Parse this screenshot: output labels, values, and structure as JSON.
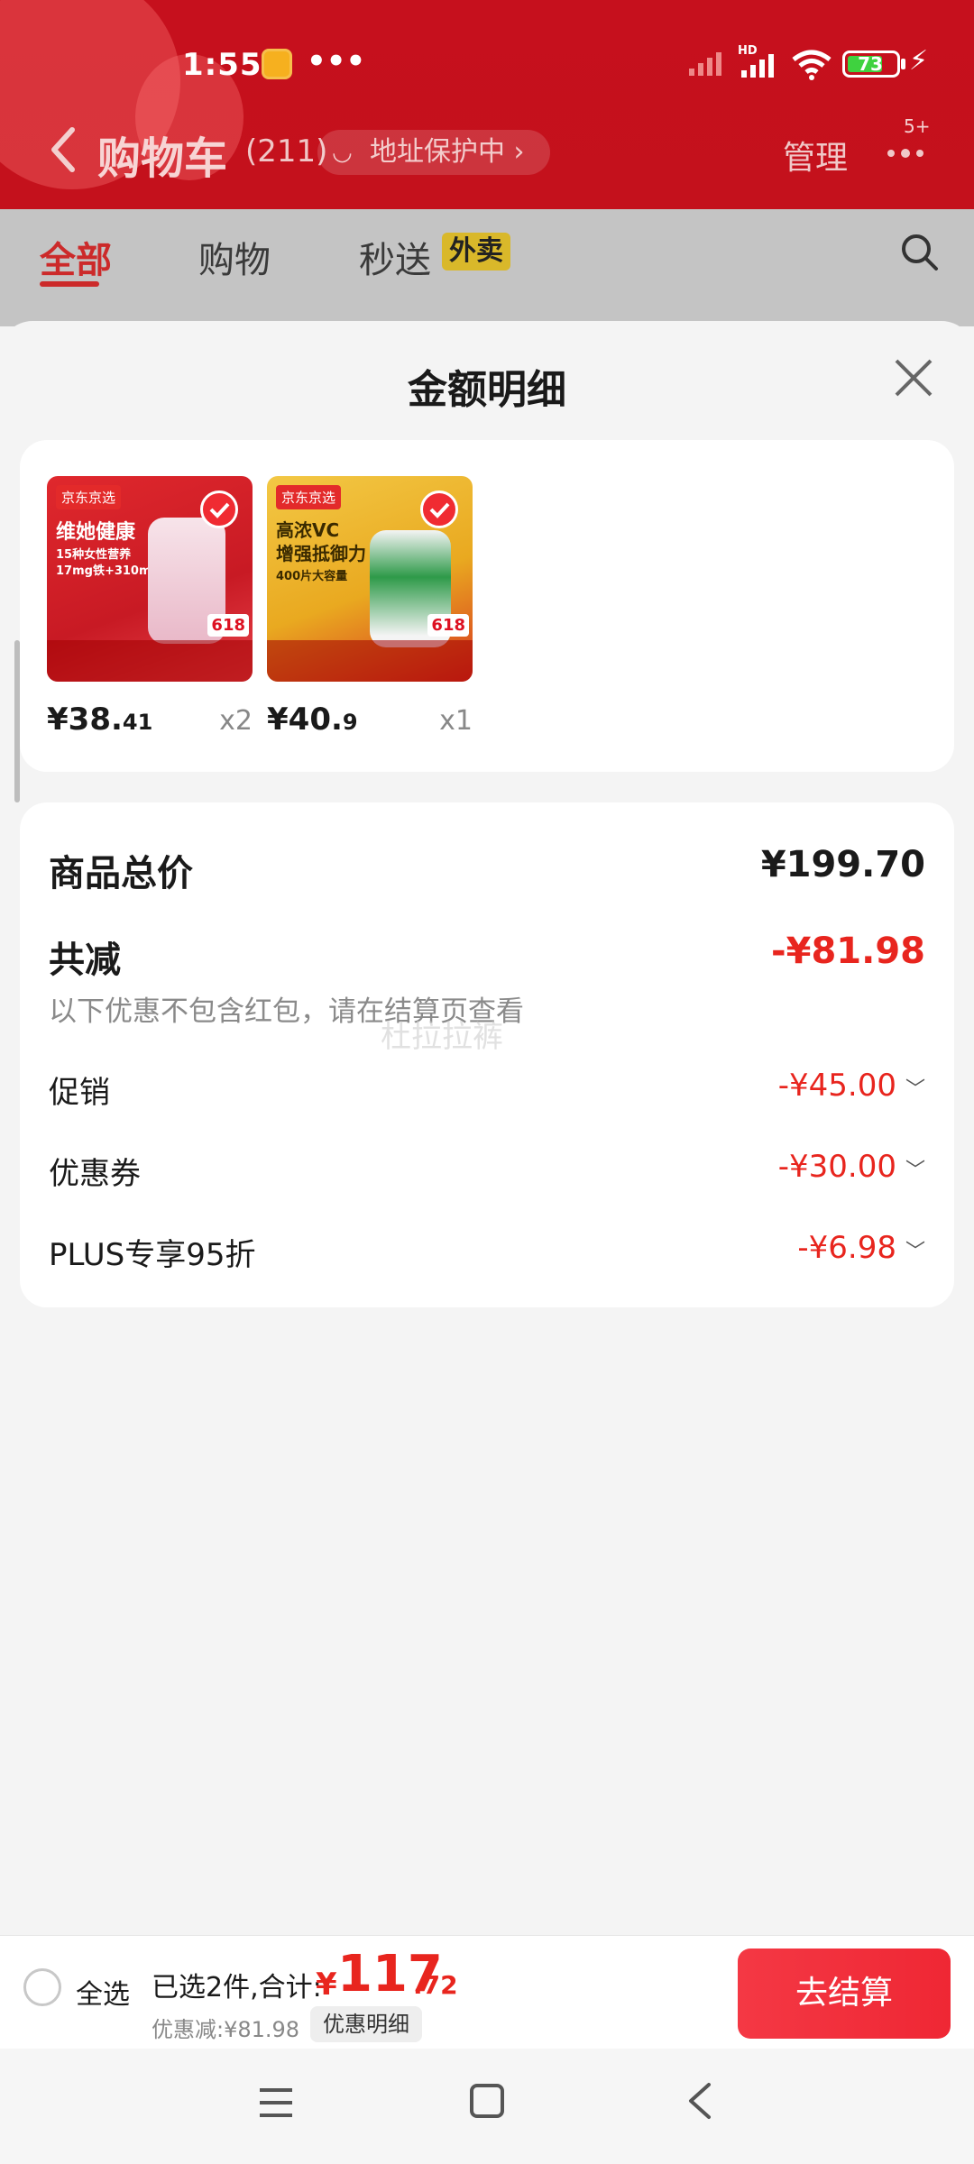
{
  "status_bar": {
    "time": "1:55",
    "dots": "•••",
    "battery": "73"
  },
  "header": {
    "title": "购物车",
    "count": "(211)",
    "address_pill": "地址保护中",
    "manage": "管理",
    "badge": "5+"
  },
  "tabs": [
    {
      "label": "全部"
    },
    {
      "label": "购物"
    },
    {
      "label": "秒送"
    }
  ],
  "tab_badge": "外卖",
  "sheet": {
    "title": "金额明细",
    "products": [
      {
        "brand": "京东京选",
        "line1": "维她健康",
        "line2": "15种女性营养",
        "line3": "17mg铁+310mg钙",
        "price_int": "¥38.",
        "price_dec": "41",
        "qty": "x2"
      },
      {
        "brand": "京东京选",
        "line1": "高浓VC",
        "line2": "增强抵御力",
        "line3": "400片大容量",
        "price_int": "¥40.",
        "price_dec": "9",
        "qty": "x1"
      }
    ],
    "summary": {
      "total_label": "商品总价",
      "total_value": "¥199.70",
      "reduce_label": "共减",
      "reduce_value": "-¥81.98",
      "note": "以下优惠不包含红包，请在结算页查看",
      "watermark": "杜拉拉裤",
      "items": [
        {
          "label": "促销",
          "value": "-¥45.00"
        },
        {
          "label": "优惠券",
          "value": "-¥30.00"
        },
        {
          "label": "PLUS专享95折",
          "value": "-¥6.98"
        }
      ]
    }
  },
  "checkout": {
    "select_all": "全选",
    "selected": "已选2件,合计:",
    "yen": "¥",
    "total_int": "117",
    "total_dec": ".72",
    "discount": "优惠减:¥81.98",
    "detail": "优惠明细",
    "button": "去结算"
  },
  "colors": {
    "brand_red": "#c4111c",
    "price_red": "#e8251e",
    "checkout_button": "#f43844"
  }
}
